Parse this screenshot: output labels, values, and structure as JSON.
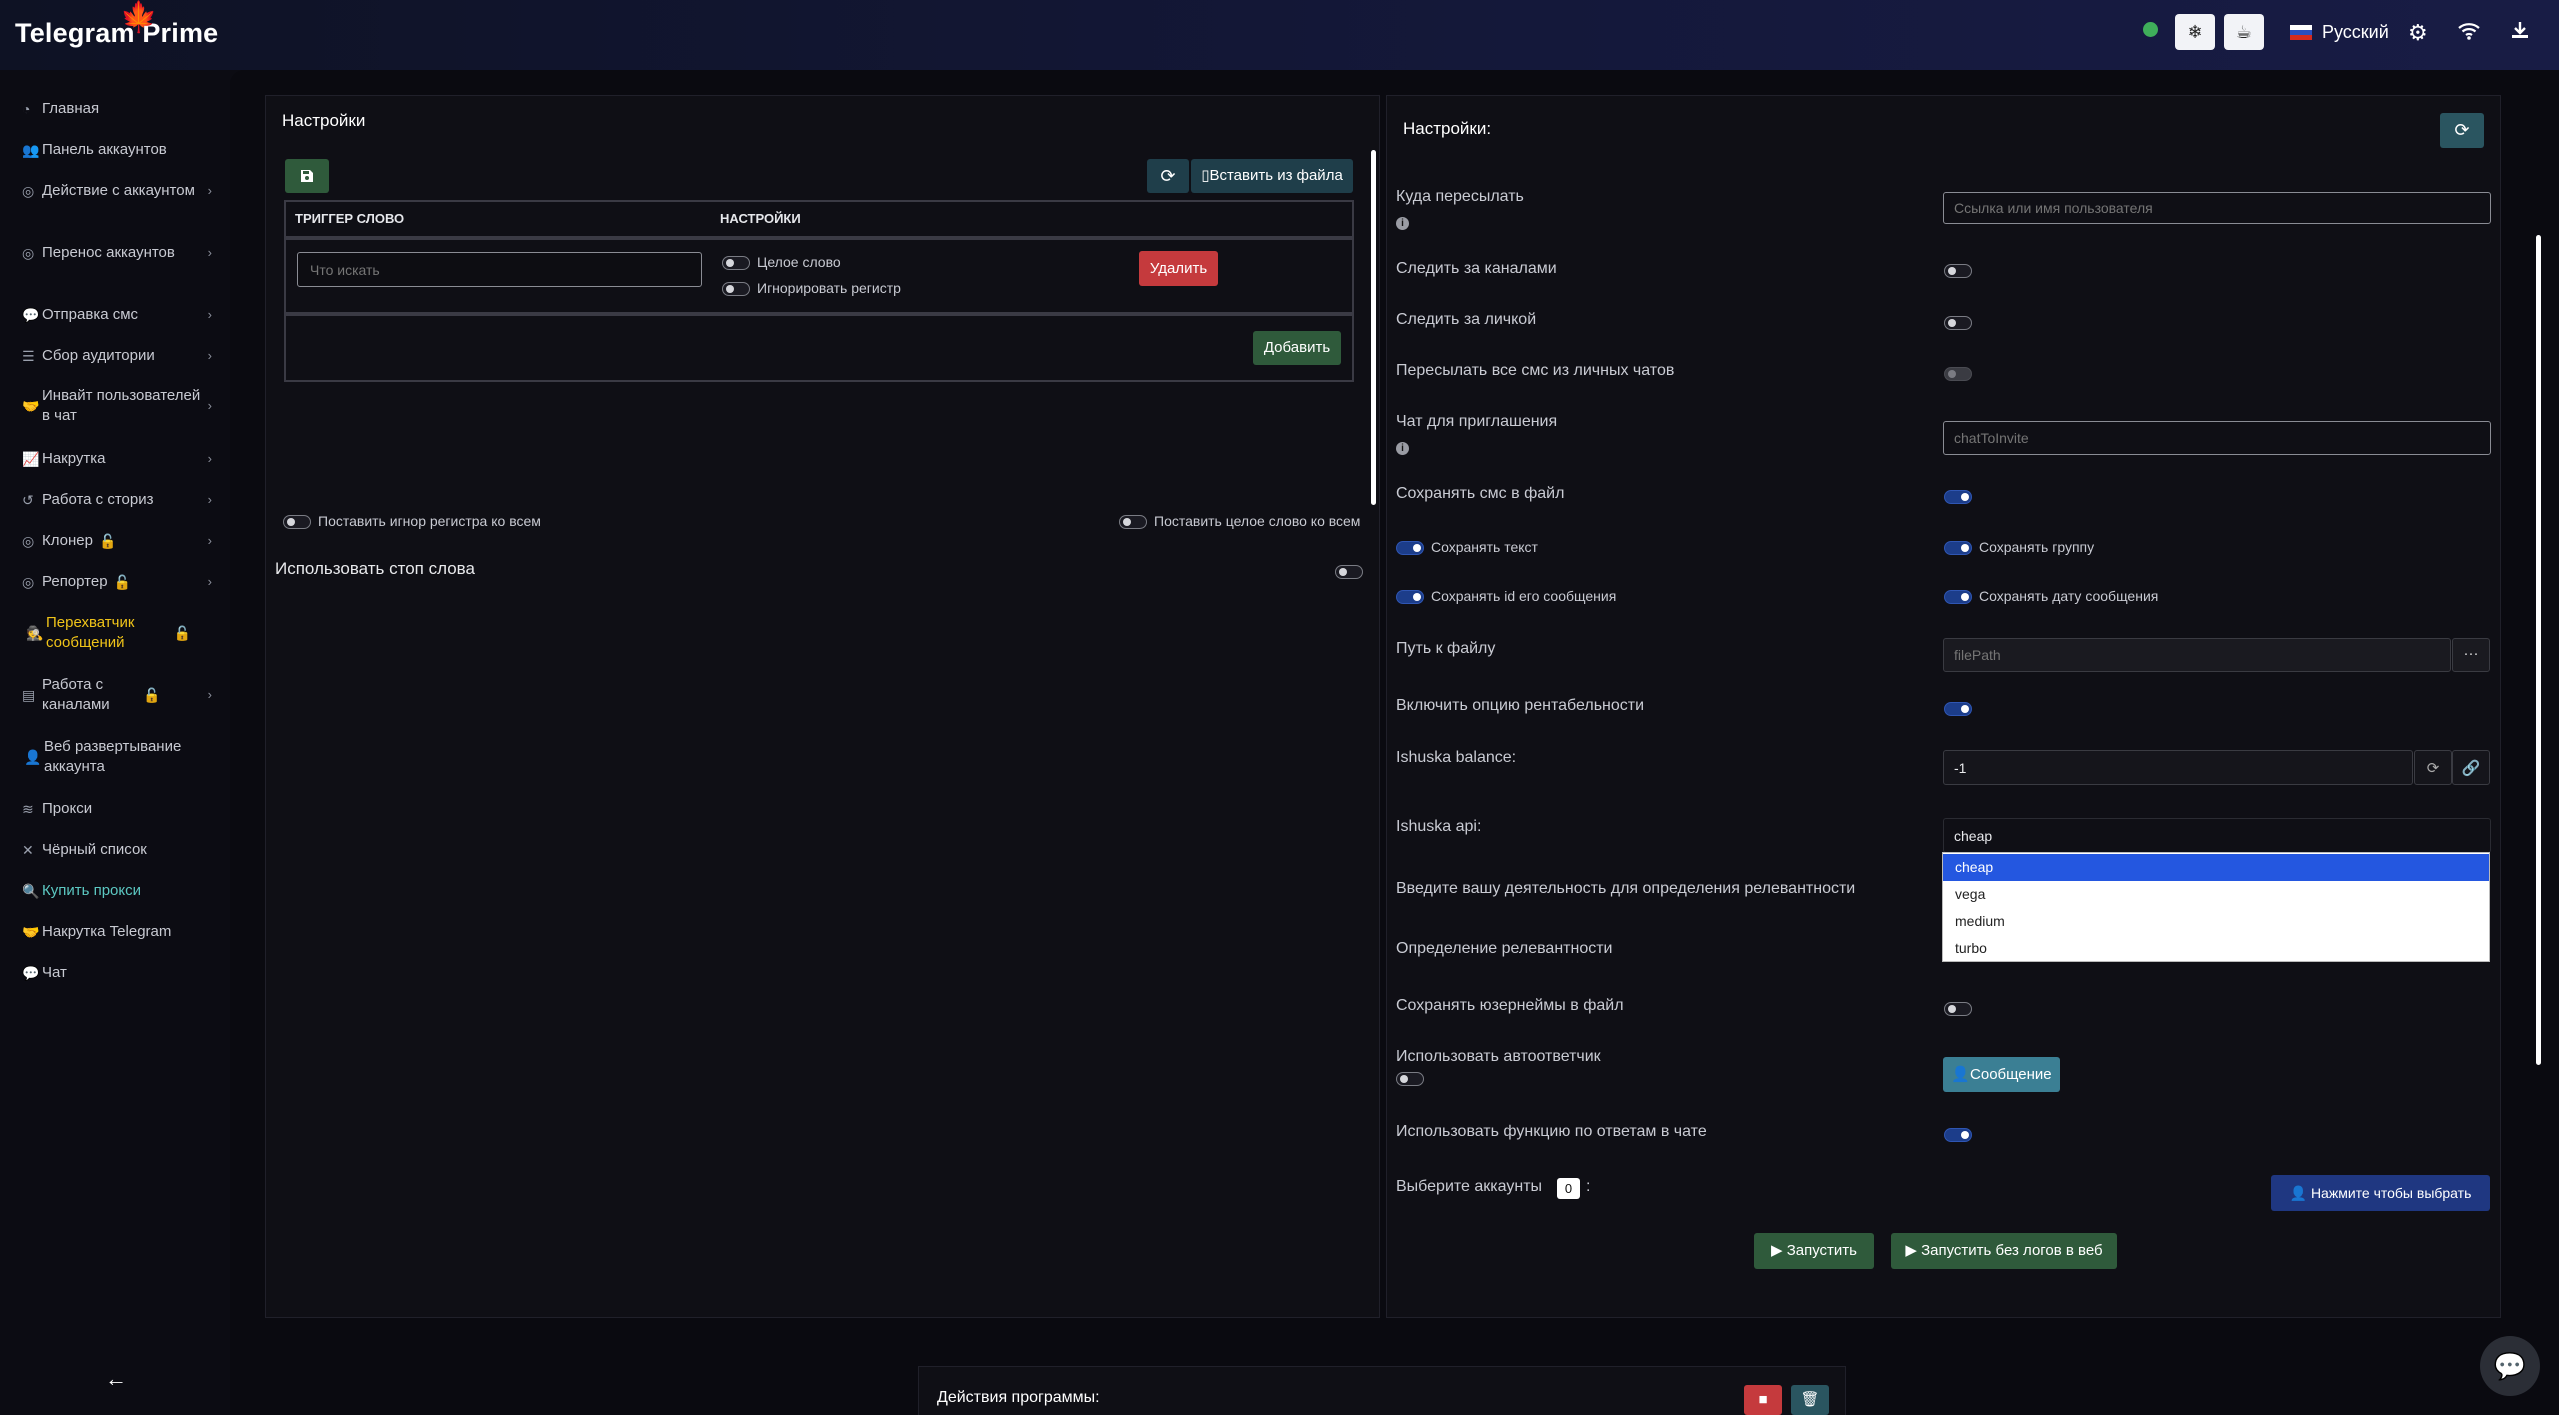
{
  "header": {
    "logo": "Telegram Prime",
    "language": "Русский"
  },
  "sidebar": {
    "items": [
      {
        "label": "Главная",
        "icon": "dashboard-icon"
      },
      {
        "label": "Панель аккаунтов",
        "icon": "users-icon"
      },
      {
        "label": "Действие с аккаунтом",
        "icon": "user-circle-icon"
      },
      {
        "label": "Перенос аккаунтов",
        "icon": "user-circle-icon"
      },
      {
        "label": "Отправка смс",
        "icon": "comments-icon"
      },
      {
        "label": "Сбор аудитории",
        "icon": "database-icon"
      },
      {
        "label": "Инвайт пользователей в чат",
        "icon": "handshake-icon"
      },
      {
        "label": "Накрутка",
        "icon": "chart-line-icon"
      },
      {
        "label": "Работа с сториз",
        "icon": "history-icon"
      },
      {
        "label": "Клонер",
        "icon": "user-circle-icon"
      },
      {
        "label": "Репортер",
        "icon": "user-circle-icon"
      },
      {
        "label": "Перехватчик сообщений",
        "icon": "user-secret-icon"
      },
      {
        "label": "Работа с каналами",
        "icon": "address-book-icon"
      },
      {
        "label": "Веб развертывание аккаунта",
        "icon": "user-icon"
      },
      {
        "label": "Прокси",
        "icon": "wifi-icon"
      },
      {
        "label": "Чёрный список",
        "icon": "times-icon"
      },
      {
        "label": "Купить прокси",
        "icon": "search-icon"
      },
      {
        "label": "Накрутка Telegram",
        "icon": "handshake-icon"
      },
      {
        "label": "Чат",
        "icon": "comments-icon"
      }
    ]
  },
  "left_panel": {
    "title": "Настройки",
    "paste_file_label": "Вставить из файла",
    "col_trigger": "ТРИГГЕР СЛОВО",
    "col_settings": "НАСТРОЙКИ",
    "search_placeholder": "Что искать",
    "whole_word": "Целое слово",
    "ignore_case": "Игнорировать регистр",
    "delete_label": "Удалить",
    "add_label": "Добавить",
    "ignore_case_all": "Поставить игнор регистра ко всем",
    "whole_word_all": "Поставить целое слово ко всем",
    "use_stop_words": "Использовать стоп слова"
  },
  "right_panel": {
    "title": "Настройки:",
    "forward_to": "Куда пересылать",
    "forward_placeholder": "Ссылка или имя пользователя",
    "watch_channels": "Следить за каналами",
    "watch_private": "Следить за личкой",
    "forward_all_private": "Пересылать все смс из личных чатов",
    "invite_chat": "Чат для приглашения",
    "invite_placeholder": "chatToInvite",
    "save_sms_file": "Сохранять смс в файл",
    "save_text": "Сохранять текст",
    "save_group": "Сохранять группу",
    "save_msg_id": "Сохранять id его сообщения",
    "save_msg_date": "Сохранять дату сообщения",
    "file_path": "Путь к файлу",
    "file_path_placeholder": "filePath",
    "profitability": "Включить опцию рентабельности",
    "ishuska_balance": "Ishuska balance:",
    "balance_value": "-1",
    "ishuska_api": "Ishuska api:",
    "api_selected": "cheap",
    "api_options": [
      "cheap",
      "vega",
      "medium",
      "turbo"
    ],
    "activity": "Введите вашу деятельность для определения релевантности",
    "relevance": "Определение релевантности",
    "save_usernames": "Сохранять юзернеймы в файл",
    "use_autoresponder": "Использовать автоответчик",
    "message_btn": "Сообщение",
    "use_reply_function": "Использовать функцию по ответам в чате",
    "choose_accounts": "Выберите аккаунты",
    "accounts_count": "0",
    "choose_accounts_colon": ":",
    "click_to_choose": "Нажмите чтобы выбрать",
    "start": "Запустить",
    "start_no_logs": "Запустить без логов в веб"
  },
  "bottom_panel": {
    "title": "Действия программы:"
  }
}
